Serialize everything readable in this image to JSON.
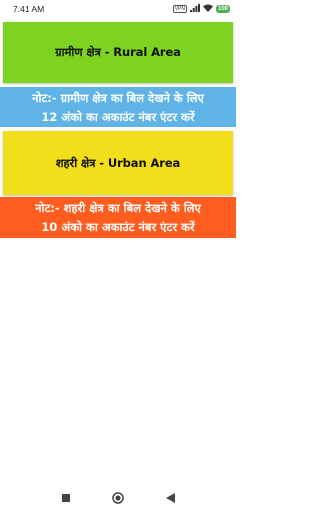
{
  "status_bar": {
    "time": "7:41 AM",
    "vpn_label": "VPN",
    "battery": "100",
    "icons": [
      "vpn-icon",
      "signal-icon",
      "wifi-icon",
      "battery-icon"
    ]
  },
  "rural": {
    "label": "ग्रामीण क्षेत्र - Rural Area",
    "note_line1": "नोट:- ग्रामीण क्षेत्र का बिल देखने के लिए",
    "note_line2": "12 अंको का अकाउंट नंबर एंटर करें",
    "color": "#7ed321",
    "note_color": "#5fb3e6"
  },
  "urban": {
    "label": "शहरी क्षेत्र - Urban Area",
    "note_line1": "नोट:- शहरी क्षेत्र का बिल देखने के लिए",
    "note_line2": "10 अंको का अकाउंट नंबर एंटर करें",
    "color": "#f2de1a",
    "note_color": "#ff5c1f"
  },
  "nav": {
    "icons": [
      "recents-square-icon",
      "home-circle-icon",
      "back-triangle-icon"
    ]
  }
}
